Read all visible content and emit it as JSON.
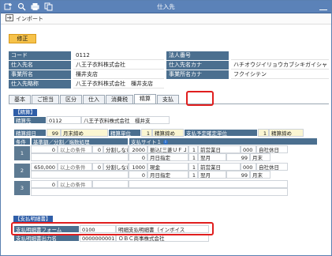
{
  "window": {
    "title": "仕入先"
  },
  "toolbar": {
    "icons": [
      "new-icon",
      "search-icon",
      "print-icon",
      "copy-icon"
    ]
  },
  "importbar": {
    "label": "インポート"
  },
  "mode": {
    "label": "修正"
  },
  "info": {
    "code": {
      "label": "コード",
      "value": "0112"
    },
    "name": {
      "label": "仕入先名",
      "value": "八王子衣料株式会社"
    },
    "office": {
      "label": "事業所名",
      "value": "橿井支店"
    },
    "contact": {
      "label": "仕入先略称",
      "value": "八王子衣料株式会社　橿井支店"
    },
    "corp": {
      "label": "法人番号",
      "value": ""
    },
    "name_kana": {
      "label": "仕入先名カナ",
      "value": "ハチオウジイリョウカブシキガイシャ"
    },
    "office_kana": {
      "label": "事業所名カナ",
      "value": "フクイシテン"
    }
  },
  "tabs": [
    {
      "label": "基本"
    },
    {
      "label": "ご担当"
    },
    {
      "label": "区分"
    },
    {
      "label": "仕入"
    },
    {
      "label": "消費税"
    },
    {
      "label": "精算"
    },
    {
      "label": "支払"
    }
  ],
  "seisan": {
    "section_title": "【精算】",
    "seisansaki": {
      "label": "精算先",
      "code": "0112",
      "name": "八王子衣料株式会社　橿井支"
    },
    "seisanbi": {
      "label": "精算締日",
      "day": "99",
      "text": "月末締め"
    },
    "tani": {
      "label": "精算単位",
      "day": "1",
      "text": "精算締め"
    },
    "yotei": {
      "label": "支払予定確定単位",
      "day": "1",
      "text": "精算締め"
    },
    "cond_header": {
      "joken": "条件",
      "kijun": "基準額／分割／端数処理",
      "site": "支払サイト１"
    },
    "conditions": [
      {
        "no": "1",
        "amount": "0",
        "above": "以上の条件",
        "div_code": "0",
        "div_text": "分割しない",
        "r1_code": "2000",
        "r1_text": "振込[三菱ＵＦＪ",
        "r1_n": "1",
        "r1_t": "前営業日",
        "r1_c3": "000",
        "r1_t3": "自社休日",
        "r2_code": "0",
        "r2_text": "月日指定",
        "r2_n": "1",
        "r2_t": "翌月",
        "r2_d": "99",
        "r2_e": "月末"
      },
      {
        "no": "2",
        "amount": "650,000",
        "above": "以上の条件",
        "div_code": "0",
        "div_text": "分割しない",
        "r1_code": "1000",
        "r1_text": "現金",
        "r1_n": "1",
        "r1_t": "前営業日",
        "r1_c3": "000",
        "r1_t3": "自社休日",
        "r2_code": "0",
        "r2_text": "月日指定",
        "r2_n": "1",
        "r2_t": "翌月",
        "r2_d": "99",
        "r2_e": "月末"
      },
      {
        "no": "3",
        "amount": "0",
        "above": "以上の条件",
        "div_code": "",
        "div_text": "",
        "r1_code": "",
        "r1_text": "",
        "r1_n": "",
        "r1_t": "",
        "r1_c3": "",
        "r1_t3": "",
        "r2_code": "",
        "r2_text": "",
        "r2_n": "",
        "r2_t": "",
        "r2_d": "",
        "r2_e": ""
      }
    ]
  },
  "meisaisho": {
    "section_title": "【支払明細書】",
    "form": {
      "label": "支払明細書フォーム",
      "code": "0100",
      "name": "明細支払明細書（インボイス"
    },
    "output": {
      "label": "支払明細書出力名",
      "code": "0000000001",
      "name": "ＯＢＣ商事株式会社"
    }
  },
  "colors": {
    "titlebar": "#5b82b8",
    "label_bg": "#4b6f8f",
    "highlight": "#e01e1e",
    "mode_badge": "#f6c24a"
  }
}
